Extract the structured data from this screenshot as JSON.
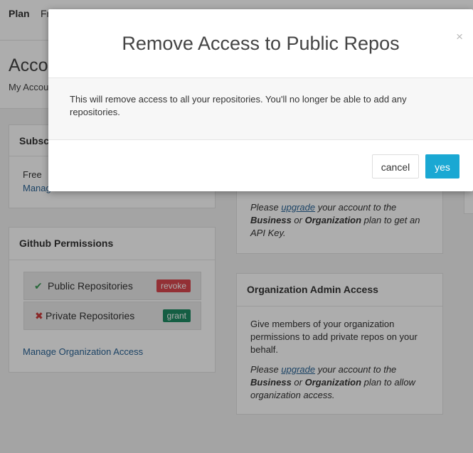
{
  "nav": {
    "plan": "Plan",
    "partial_item": "Fr"
  },
  "header": {
    "title_partial": "Accou",
    "breadcrumb_partial": "My Accou"
  },
  "subscription": {
    "title_partial": "Subscr",
    "plan": "Free",
    "manage_partial": "Manag"
  },
  "github_permissions": {
    "title": "Github Permissions",
    "repos": [
      {
        "label": "Public Repositories",
        "status_icon": "check-icon",
        "action": "revoke",
        "action_color": "#d9474f"
      },
      {
        "label": "Private Repositories",
        "status_icon": "x-icon",
        "action": "grant",
        "action_color": "#1e8b63"
      }
    ],
    "manage_link": "Manage Organization Access"
  },
  "api_key_card": {
    "note_prefix": "Please ",
    "link": "upgrade",
    "note_mid": " your account to the ",
    "plan1": "Business",
    "or": " or ",
    "plan2": "Organization",
    "note_suffix": " plan to get an API Key."
  },
  "org_admin": {
    "title": "Organization Admin Access",
    "description": "Give members of your organization permissions to add private repos on your behalf.",
    "note_prefix": "Please ",
    "link": "upgrade",
    "note_mid": " your account to the ",
    "plan1": "Business",
    "or": " or ",
    "plan2": "Organization",
    "note_suffix": " plan to allow organization access."
  },
  "modal": {
    "title": "Remove Access to Public Repos",
    "close_glyph": "×",
    "message": "This will remove access to all your repositories. You'll no longer be able to add any repositories.",
    "cancel_label": "cancel",
    "confirm_label": "yes",
    "confirm_color": "#1aa8d3"
  }
}
